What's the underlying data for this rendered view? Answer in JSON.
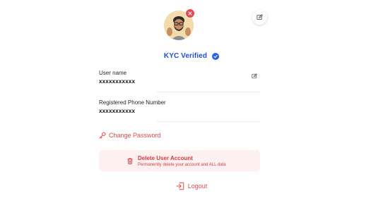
{
  "profile": {
    "avatar_icon": "memoji-avatar",
    "remove_icon": "close-icon",
    "edit_icon": "edit-icon"
  },
  "kyc": {
    "label": "KYC Verified",
    "badge_icon": "check-badge-icon",
    "color": "#1f4fd1"
  },
  "fields": {
    "username": {
      "label": "User name",
      "value": "xxxxxxxxxxx",
      "edit_icon": "edit-icon"
    },
    "phone": {
      "label": "Registered Phone Number",
      "value": "xxxxxxxxxxx"
    }
  },
  "actions": {
    "change_password": {
      "label": "Change Password",
      "icon": "key-icon"
    },
    "delete_account": {
      "title": "Delete User Account",
      "subtitle": "Permanently delete your account and ALL data",
      "icon": "trash-icon"
    },
    "logout": {
      "label": "Logout",
      "icon": "logout-icon"
    }
  },
  "colors": {
    "danger": "#e5484d",
    "danger_bg": "#fdf0f0",
    "accent": "#2563eb"
  }
}
